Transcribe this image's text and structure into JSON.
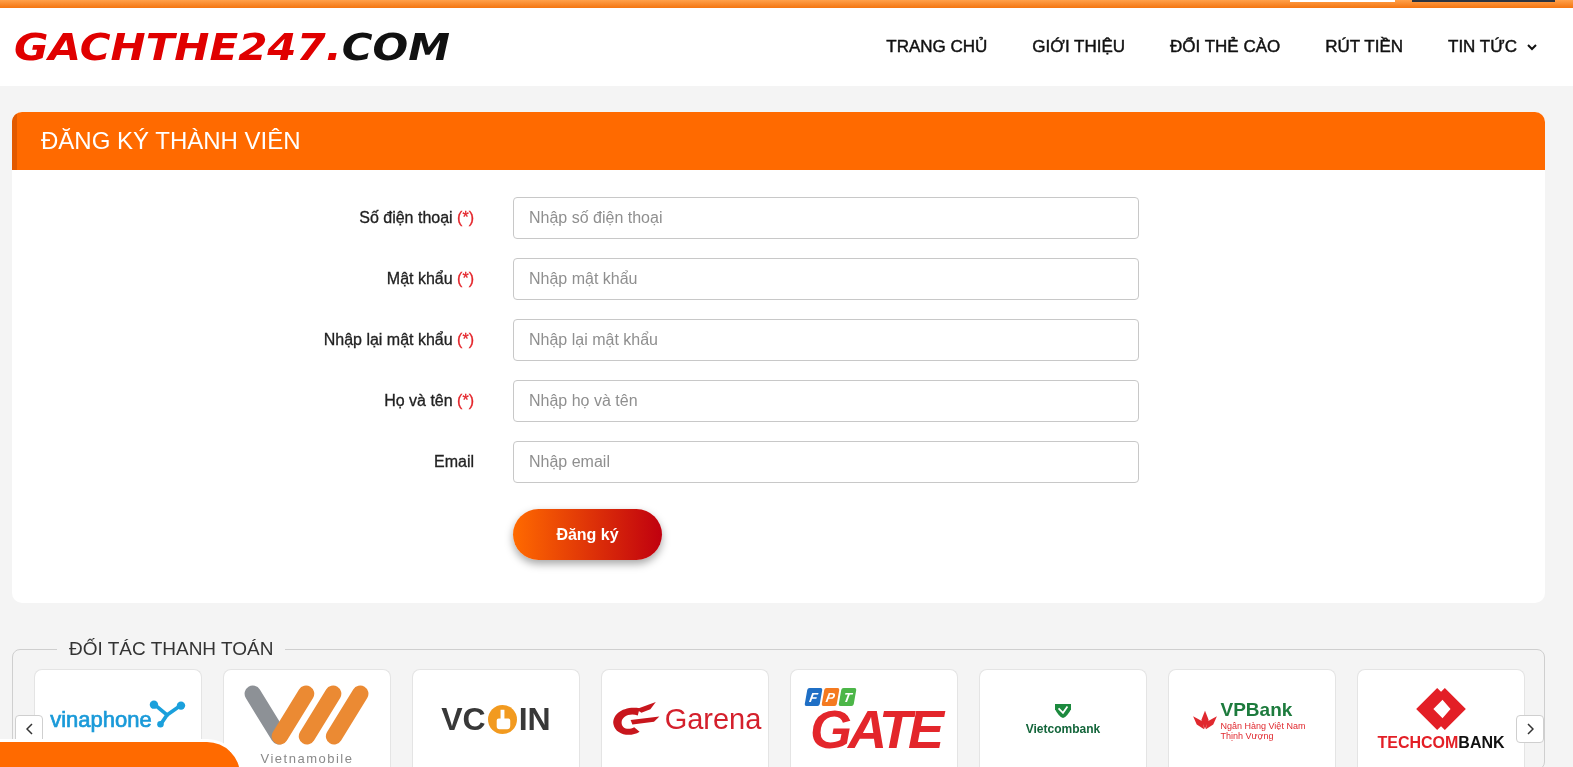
{
  "header": {
    "logo": {
      "brand": "GACHTHE247.",
      "suffix": "COM"
    },
    "nav": [
      {
        "label": "TRANG CHỦ",
        "dropdown": false
      },
      {
        "label": "GIỚI THIỆU",
        "dropdown": false
      },
      {
        "label": "ĐỔI THẺ CÀO",
        "dropdown": false
      },
      {
        "label": "RÚT TIỀN",
        "dropdown": false
      },
      {
        "label": "TIN TỨC",
        "dropdown": true
      }
    ]
  },
  "register": {
    "title": "ĐĂNG KÝ THÀNH VIÊN",
    "fields": [
      {
        "label": "Số điện thoại",
        "required_mark": "(*)",
        "placeholder": "Nhập số điện thoại"
      },
      {
        "label": "Mật khẩu",
        "required_mark": "(*)",
        "placeholder": "Nhập mật khẩu"
      },
      {
        "label": "Nhập lại mật khẩu",
        "required_mark": "(*)",
        "placeholder": "Nhập lại mật khẩu"
      },
      {
        "label": "Họ và tên",
        "required_mark": "(*)",
        "placeholder": "Nhập họ và tên"
      },
      {
        "label": "Email",
        "placeholder": "Nhập email"
      }
    ],
    "submit": "Đăng ký"
  },
  "partners": {
    "title": "ĐỐI TÁC THANH TOÁN",
    "items": [
      {
        "kind": "vinaphone",
        "text": "vinaphone"
      },
      {
        "kind": "vietnamobile",
        "text": "Vietnamobile"
      },
      {
        "kind": "vcoin",
        "parts": [
          "VC",
          "IN"
        ]
      },
      {
        "kind": "garena",
        "text": "Garena"
      },
      {
        "kind": "fpt_gate",
        "tiles": [
          "F",
          "P",
          "T"
        ],
        "text": "GATE"
      },
      {
        "kind": "vietcombank",
        "text": "Vietcombank"
      },
      {
        "kind": "vpbank",
        "text": "VPBank",
        "tagline": "Ngân Hàng Việt Nam Thịnh Vượng"
      },
      {
        "kind": "techcombank",
        "parts": [
          "TECHCOM",
          "BANK"
        ]
      }
    ]
  }
}
